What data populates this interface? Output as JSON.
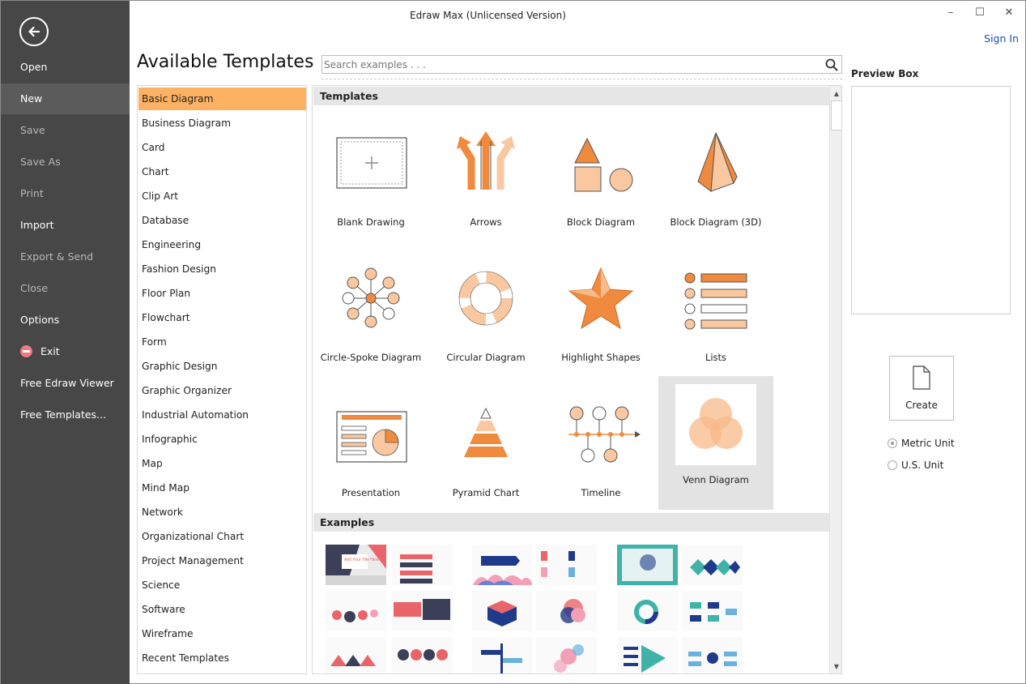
{
  "window": {
    "title": "Edraw Max (Unlicensed Version)",
    "sign_in": "Sign In",
    "minimize": "–",
    "maximize": "☐",
    "close": "✕"
  },
  "sidebar": {
    "items": [
      {
        "label": "Open",
        "state": "normal"
      },
      {
        "label": "New",
        "state": "active"
      },
      {
        "label": "Save",
        "state": "disabled"
      },
      {
        "label": "Save As",
        "state": "disabled"
      },
      {
        "label": "Print",
        "state": "disabled"
      },
      {
        "label": "Import",
        "state": "normal"
      },
      {
        "label": "Export & Send",
        "state": "disabled"
      },
      {
        "label": "Close",
        "state": "disabled"
      },
      {
        "label": "Options",
        "state": "normal"
      },
      {
        "label": "Exit",
        "state": "normal"
      },
      {
        "label": "Free Edraw Viewer",
        "state": "normal"
      },
      {
        "label": "Free Templates...",
        "state": "normal"
      }
    ]
  },
  "main": {
    "title": "Available Templates",
    "search": {
      "placeholder": "Search examples . . .",
      "value": ""
    }
  },
  "categories": [
    "Basic Diagram",
    "Business Diagram",
    "Card",
    "Chart",
    "Clip Art",
    "Database",
    "Engineering",
    "Fashion Design",
    "Floor Plan",
    "Flowchart",
    "Form",
    "Graphic Design",
    "Graphic Organizer",
    "Industrial Automation",
    "Infographic",
    "Map",
    "Mind Map",
    "Network",
    "Organizational Chart",
    "Project Management",
    "Science",
    "Software",
    "Wireframe",
    "Recent Templates"
  ],
  "selected_category": "Basic Diagram",
  "templates_header": "Templates",
  "examples_header": "Examples",
  "templates": [
    {
      "label": "Blank Drawing",
      "icon": "blank-drawing-icon"
    },
    {
      "label": "Arrows",
      "icon": "arrows-icon"
    },
    {
      "label": "Block Diagram",
      "icon": "block-diagram-icon"
    },
    {
      "label": "Block Diagram (3D)",
      "icon": "block-diagram-3d-icon"
    },
    {
      "label": "Circle-Spoke Diagram",
      "icon": "circle-spoke-icon"
    },
    {
      "label": "Circular Diagram",
      "icon": "circular-diagram-icon"
    },
    {
      "label": "Highlight Shapes",
      "icon": "star-icon"
    },
    {
      "label": "Lists",
      "icon": "lists-icon"
    },
    {
      "label": "Presentation",
      "icon": "presentation-icon"
    },
    {
      "label": "Pyramid Chart",
      "icon": "pyramid-icon"
    },
    {
      "label": "Timeline",
      "icon": "timeline-icon"
    },
    {
      "label": "Venn Diagram",
      "icon": "venn-icon"
    }
  ],
  "selected_template": "Venn Diagram",
  "examples": {
    "title_text": "Add Your Title Here"
  },
  "right_panel": {
    "preview_label": "Preview Box",
    "create_label": "Create",
    "units": [
      {
        "label": "Metric Unit",
        "checked": true
      },
      {
        "label": "U.S. Unit",
        "checked": false
      }
    ]
  },
  "colors": {
    "accent_orange": "#f08a3e",
    "light_orange": "#fac8a0",
    "selection_orange": "#fdb162",
    "sidebar_bg": "#474747"
  }
}
